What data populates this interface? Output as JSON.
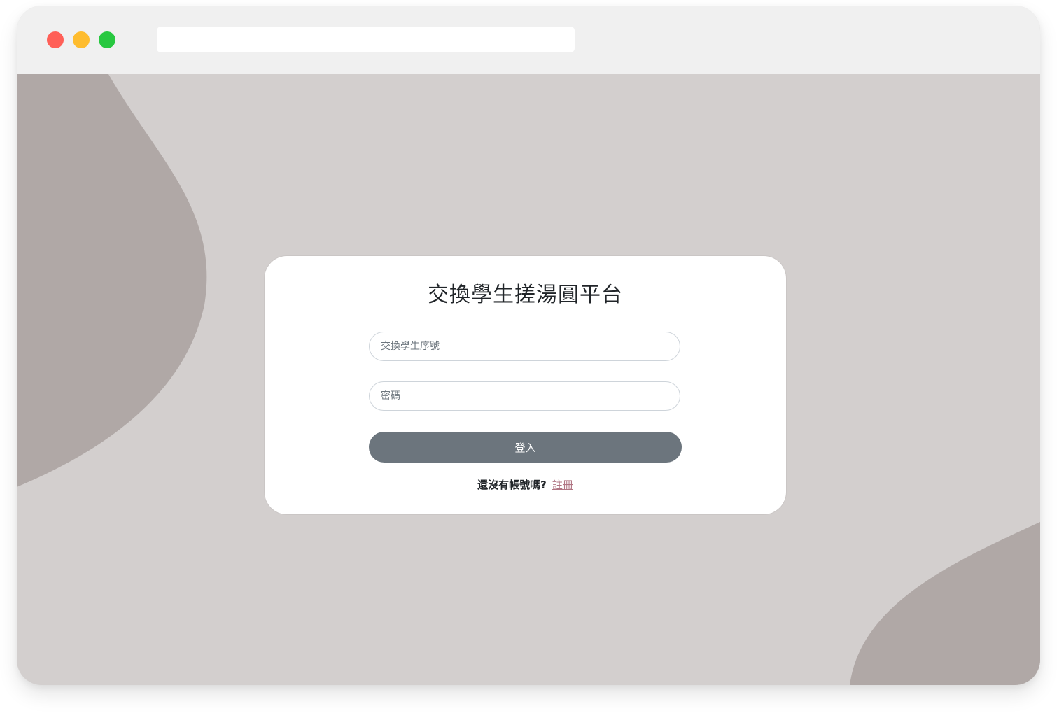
{
  "window": {
    "colors": {
      "close": "#ff5f57",
      "minimize": "#febc2e",
      "zoom": "#28c840",
      "titlebar": "#f0f0f0",
      "page_background": "#d3cfce",
      "blob": "#b0a8a6"
    }
  },
  "address_bar": {
    "value": ""
  },
  "login": {
    "title": "交換學生搓湯圓平台",
    "id_placeholder": "交換學生序號",
    "password_placeholder": "密碼",
    "login_label": "登入",
    "no_account_text": "還沒有帳號嗎?",
    "register_link": "註冊",
    "button_color": "#6c757d",
    "link_color": "#b07583"
  }
}
